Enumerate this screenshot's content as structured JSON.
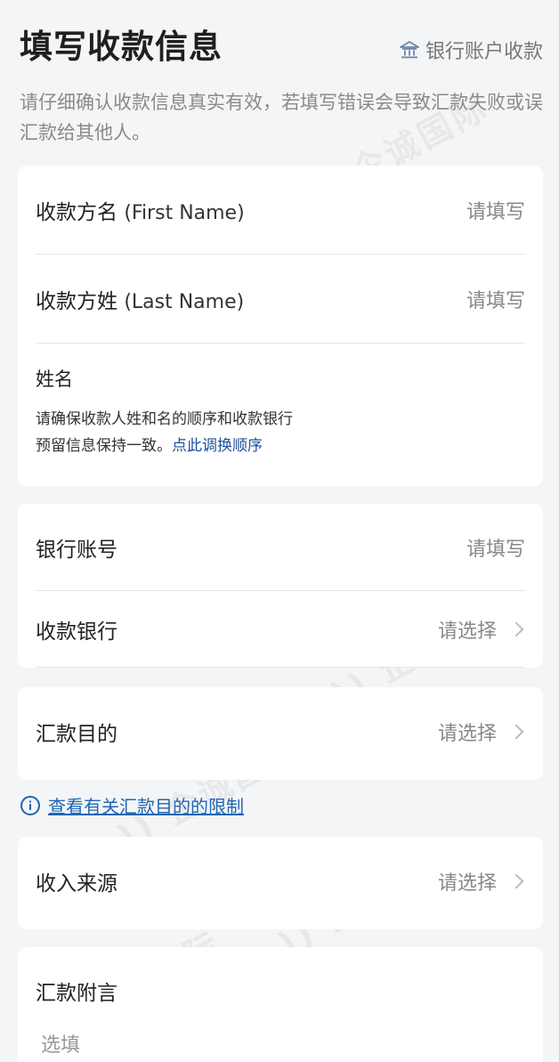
{
  "header": {
    "title": "填写收款信息",
    "account_type_label": "银行账户收款",
    "account_type_icon": "bank-icon"
  },
  "notice": "请仔细确认收款信息真实有效，若填写错误会导致汇款失败或误汇款给其他人。",
  "name_card": {
    "first_name": {
      "label": "收款方名",
      "label_en": "(First Name)",
      "placeholder": "请填写"
    },
    "last_name": {
      "label": "收款方姓",
      "label_en": "(Last Name)",
      "placeholder": "请填写"
    },
    "name_section_title": "姓名",
    "name_hint_1": "请确保收款人姓和名的顺序和收款银行",
    "name_hint_2": "预留信息保持一致。",
    "swap_link": "点此调换顺序"
  },
  "bank_card": {
    "account_no": {
      "label": "银行账号",
      "placeholder": "请填写"
    },
    "bank": {
      "label": "收款银行",
      "placeholder": "请选择"
    }
  },
  "purpose": {
    "label": "汇款目的",
    "placeholder": "请选择"
  },
  "purpose_limit_link": "查看有关汇款目的的限制",
  "income": {
    "label": "收入来源",
    "placeholder": "请选择"
  },
  "memo": {
    "label": "汇款附言",
    "placeholder": "选填"
  },
  "colors": {
    "link": "#1f66b5",
    "background": "#f4f5f7"
  }
}
